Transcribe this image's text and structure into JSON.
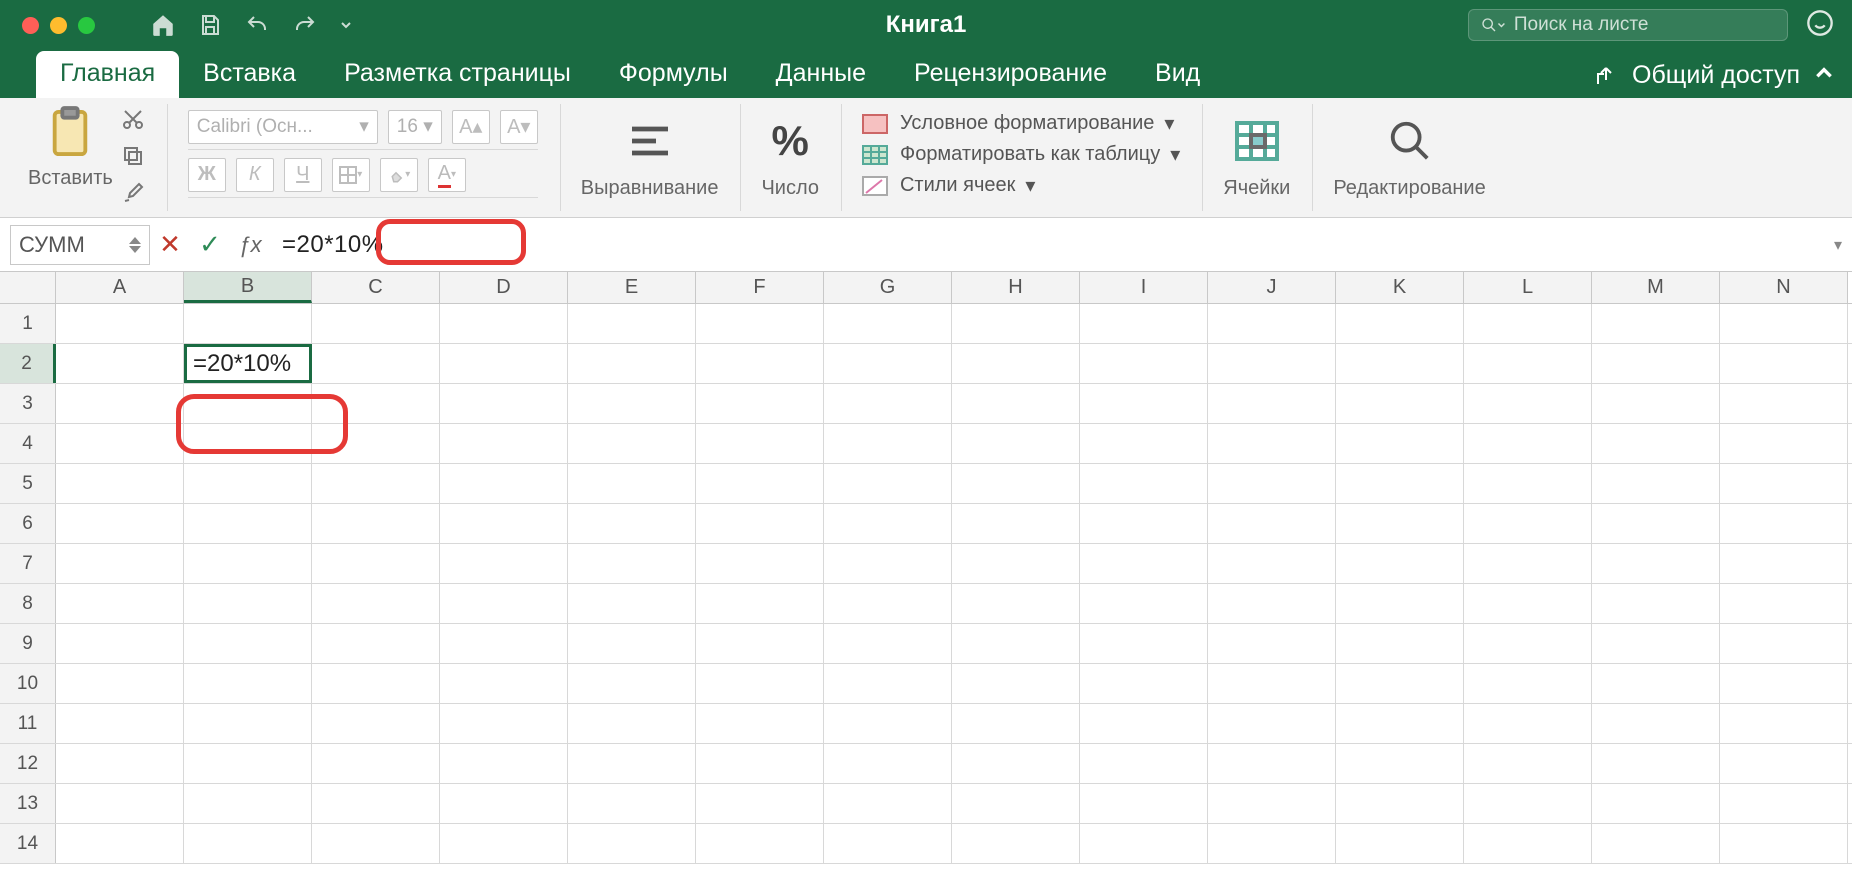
{
  "title": "Книга1",
  "search_placeholder": "Поиск на листе",
  "tabs": {
    "items": [
      "Главная",
      "Вставка",
      "Разметка страницы",
      "Формулы",
      "Данные",
      "Рецензирование",
      "Вид"
    ],
    "active_index": 0,
    "share_label": "Общий доступ"
  },
  "ribbon": {
    "paste_label": "Вставить",
    "font_name": "Calibri (Осн...",
    "font_size": "16",
    "bold": "Ж",
    "italic": "К",
    "underline": "Ч",
    "align_label": "Выравнивание",
    "number_label": "Число",
    "styles": {
      "cond": "Условное форматирование",
      "table": "Форматировать как таблицу",
      "cell": "Стили ячеек"
    },
    "cells_label": "Ячейки",
    "edit_label": "Редактирование"
  },
  "formula_bar": {
    "name_box": "СУММ",
    "formula": "=20*10%"
  },
  "grid": {
    "columns": [
      "A",
      "B",
      "C",
      "D",
      "E",
      "F",
      "G",
      "H",
      "I",
      "J",
      "K",
      "L",
      "M",
      "N"
    ],
    "visible_rows": 14,
    "active_col_index": 1,
    "active_row_index": 1,
    "editing_cell": {
      "row": 2,
      "col": "B",
      "value": "=20*10%"
    }
  }
}
